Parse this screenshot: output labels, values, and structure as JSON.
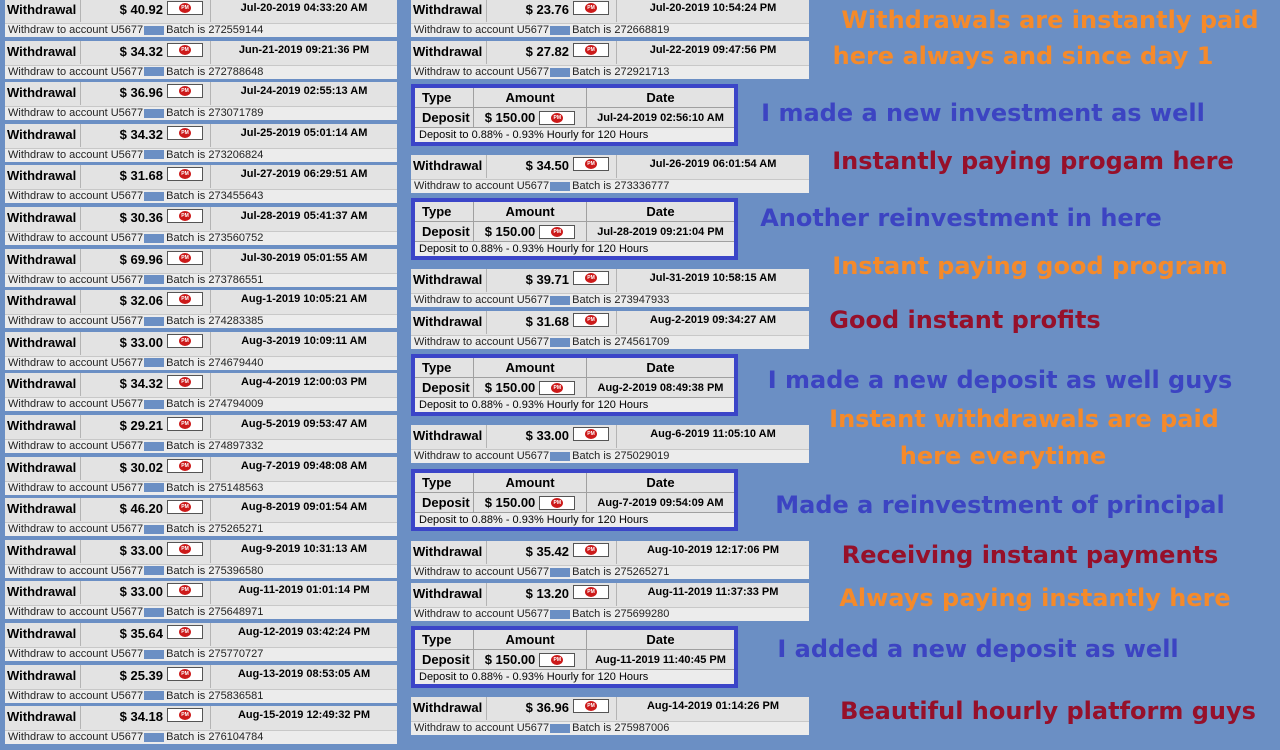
{
  "labels": {
    "withdrawal": "Withdrawal",
    "withdraw_to": "Withdraw to account U5677",
    "batch_prefix": "Batch is ",
    "type": "Type",
    "amount": "Amount",
    "date": "Date",
    "deposit": "Deposit",
    "plan": "Deposit to 0.88% - 0.93% Hourly for 120 Hours"
  },
  "colors": {
    "background": "#6b8fc4",
    "orange": "#f58a2a",
    "blue": "#3c44c2",
    "red": "#96102a",
    "box_border": "#3b45c8"
  },
  "icons": {
    "payment": "perfect-money-icon"
  },
  "left": [
    {
      "amount": "$ 40.92",
      "date": "Jul-20-2019 04:33:20 AM",
      "batch": "272559144"
    },
    {
      "amount": "$ 34.32",
      "date": "Jun-21-2019 09:21:36 PM",
      "batch": "272788648"
    },
    {
      "amount": "$ 36.96",
      "date": "Jul-24-2019 02:55:13 AM",
      "batch": "273071789"
    },
    {
      "amount": "$ 34.32",
      "date": "Jul-25-2019 05:01:14 AM",
      "batch": "273206824"
    },
    {
      "amount": "$ 31.68",
      "date": "Jul-27-2019 06:29:51 AM",
      "batch": "273455643"
    },
    {
      "amount": "$ 30.36",
      "date": "Jul-28-2019 05:41:37 AM",
      "batch": "273560752"
    },
    {
      "amount": "$ 69.96",
      "date": "Jul-30-2019 05:01:55 AM",
      "batch": "273786551"
    },
    {
      "amount": "$ 32.06",
      "date": "Aug-1-2019 10:05:21 AM",
      "batch": "274283385"
    },
    {
      "amount": "$ 33.00",
      "date": "Aug-3-2019 10:09:11 AM",
      "batch": "274679440"
    },
    {
      "amount": "$ 34.32",
      "date": "Aug-4-2019 12:00:03 PM",
      "batch": "274794009"
    },
    {
      "amount": "$ 29.21",
      "date": "Aug-5-2019 09:53:47 AM",
      "batch": "274897332"
    },
    {
      "amount": "$ 30.02",
      "date": "Aug-7-2019 09:48:08 AM",
      "batch": "275148563"
    },
    {
      "amount": "$ 46.20",
      "date": "Aug-8-2019 09:01:54 AM",
      "batch": "275265271"
    },
    {
      "amount": "$ 33.00",
      "date": "Aug-9-2019 10:31:13 AM",
      "batch": "275396580"
    },
    {
      "amount": "$ 33.00",
      "date": "Aug-11-2019 01:01:14 PM",
      "batch": "275648971"
    },
    {
      "amount": "$ 35.64",
      "date": "Aug-12-2019 03:42:24 PM",
      "batch": "275770727"
    },
    {
      "amount": "$ 25.39",
      "date": "Aug-13-2019 08:53:05 AM",
      "batch": "275836581"
    },
    {
      "amount": "$ 34.18",
      "date": "Aug-15-2019 12:49:32 PM",
      "batch": "276104784"
    }
  ],
  "middle": [
    {
      "kind": "w",
      "amount": "$ 23.76",
      "date": "Jul-20-2019 10:54:24 PM",
      "batch": "272668819"
    },
    {
      "kind": "w",
      "amount": "$ 27.82",
      "date": "Jul-22-2019 09:47:56 PM",
      "batch": "272921713"
    },
    {
      "kind": "d",
      "amount": "$ 150.00",
      "date": "Jul-24-2019 02:56:10 AM"
    },
    {
      "kind": "w",
      "amount": "$ 34.50",
      "date": "Jul-26-2019 06:01:54 AM",
      "batch": "273336777"
    },
    {
      "kind": "d",
      "amount": "$ 150.00",
      "date": "Jul-28-2019 09:21:04 PM"
    },
    {
      "kind": "w",
      "amount": "$ 39.71",
      "date": "Jul-31-2019 10:58:15 AM",
      "batch": "273947933"
    },
    {
      "kind": "w",
      "amount": "$ 31.68",
      "date": "Aug-2-2019 09:34:27 AM",
      "batch": "274561709"
    },
    {
      "kind": "d",
      "amount": "$ 150.00",
      "date": "Aug-2-2019 08:49:38 PM"
    },
    {
      "kind": "w",
      "amount": "$ 33.00",
      "date": "Aug-6-2019 11:05:10 AM",
      "batch": "275029019"
    },
    {
      "kind": "d",
      "amount": "$ 150.00",
      "date": "Aug-7-2019 09:54:09 AM"
    },
    {
      "kind": "w",
      "amount": "$ 35.42",
      "date": "Aug-10-2019 12:17:06 PM",
      "batch": "275265271"
    },
    {
      "kind": "w",
      "amount": "$ 13.20",
      "date": "Aug-11-2019 11:37:33 PM",
      "batch": "275699280"
    },
    {
      "kind": "d",
      "amount": "$ 150.00",
      "date": "Aug-11-2019 11:40:45 PM"
    },
    {
      "kind": "w",
      "amount": "$ 36.96",
      "date": "Aug-14-2019 01:14:26 PM",
      "batch": "275987006"
    }
  ],
  "captions": [
    {
      "text": "Withdrawals are instantly paid",
      "color": "orange"
    },
    {
      "text": "here always and since day 1",
      "color": "orange"
    },
    {
      "text": "I made a new investment as well",
      "color": "blue"
    },
    {
      "text": "Instantly paying progam here",
      "color": "red"
    },
    {
      "text": "Another reinvestment in here",
      "color": "blue"
    },
    {
      "text": "Instant paying good program",
      "color": "orange"
    },
    {
      "text": "Good instant profits",
      "color": "red"
    },
    {
      "text": "I made a new deposit as well guys",
      "color": "blue"
    },
    {
      "text": "Instant withdrawals are paid",
      "color": "orange"
    },
    {
      "text": "here everytime",
      "color": "orange"
    },
    {
      "text": "Made a reinvestment of principal",
      "color": "blue"
    },
    {
      "text": "Receiving instant payments",
      "color": "red"
    },
    {
      "text": "Always paying instantly here",
      "color": "orange"
    },
    {
      "text": "I added a new deposit as well",
      "color": "blue"
    },
    {
      "text": "Beautiful hourly platform guys",
      "color": "red"
    }
  ]
}
